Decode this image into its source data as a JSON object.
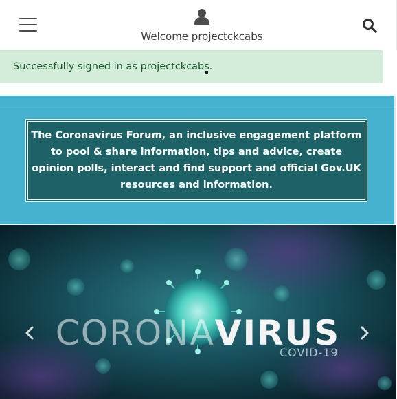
{
  "header": {
    "welcome_text": "Welcome projectckcabs",
    "icons": [
      "hamburger-menu-icon",
      "user-icon",
      "search-icon"
    ]
  },
  "alert": {
    "message": "Successfully signed in as projectckcabs."
  },
  "banner": {
    "text": "The Coronavirus Forum, an inclusive engagement platform to pool & share information, tips and advice, create opinion polls, interact and find support and official Gov.UK resources and information."
  },
  "carousel": {
    "title_part1": "CORONA",
    "title_part2": "VIRUS",
    "subtitle": "COVID-19",
    "controls": [
      "chevron-left-icon",
      "chevron-right-icon"
    ]
  },
  "colors": {
    "banner_bg": "#45b3cf",
    "banner_box_bg": "#1d6267",
    "alert_bg": "#d4edda",
    "alert_text": "#155724"
  }
}
